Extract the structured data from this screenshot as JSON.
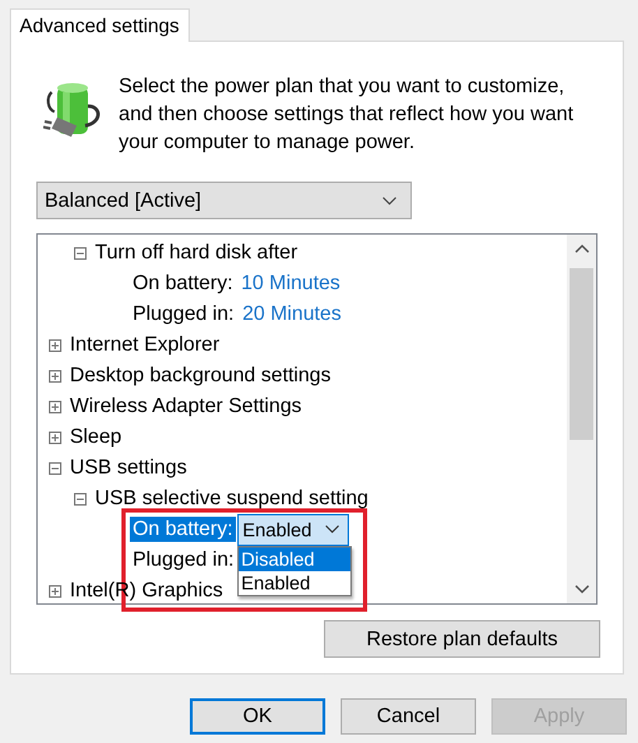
{
  "tabs": [
    {
      "label": "Advanced settings",
      "selected": true
    }
  ],
  "intro": "Select the power plan that you want to customize, and then choose settings that reflect how you want your computer to manage power.",
  "plan_dropdown": {
    "value": "Balanced [Active]"
  },
  "tree": {
    "items": [
      {
        "children": [
          {
            "label": "Turn off hard disk after",
            "expanded": true,
            "children": [
              {
                "kind": "value",
                "label": "On battery:",
                "value": "10 Minutes",
                "selected": false
              },
              {
                "kind": "value",
                "label": "Plugged in:",
                "value": "20 Minutes",
                "selected": false
              }
            ]
          }
        ]
      },
      {
        "label": "Internet Explorer",
        "expanded": false
      },
      {
        "label": "Desktop background settings",
        "expanded": false
      },
      {
        "label": "Wireless Adapter Settings",
        "expanded": false
      },
      {
        "label": "Sleep",
        "expanded": false
      },
      {
        "label": "USB settings",
        "expanded": true,
        "children": [
          {
            "label": "USB selective suspend setting",
            "expanded": true,
            "children": [
              {
                "kind": "combo",
                "label": "On battery:",
                "selected": true,
                "value": "Enabled",
                "expanded": true,
                "options": [
                  {
                    "label": "Disabled",
                    "highlighted": true
                  },
                  {
                    "label": "Enabled",
                    "highlighted": false
                  }
                ]
              },
              {
                "kind": "covered",
                "label": "Plugged in:",
                "selected": false
              }
            ]
          }
        ]
      },
      {
        "label": "Intel(R) Graphics",
        "expanded": false
      }
    ]
  },
  "restore_button": "Restore plan defaults",
  "buttons": [
    {
      "label": "OK",
      "default": true,
      "disabled": false
    },
    {
      "label": "Cancel",
      "default": false,
      "disabled": false
    },
    {
      "label": "Apply",
      "default": false,
      "disabled": true
    }
  ]
}
